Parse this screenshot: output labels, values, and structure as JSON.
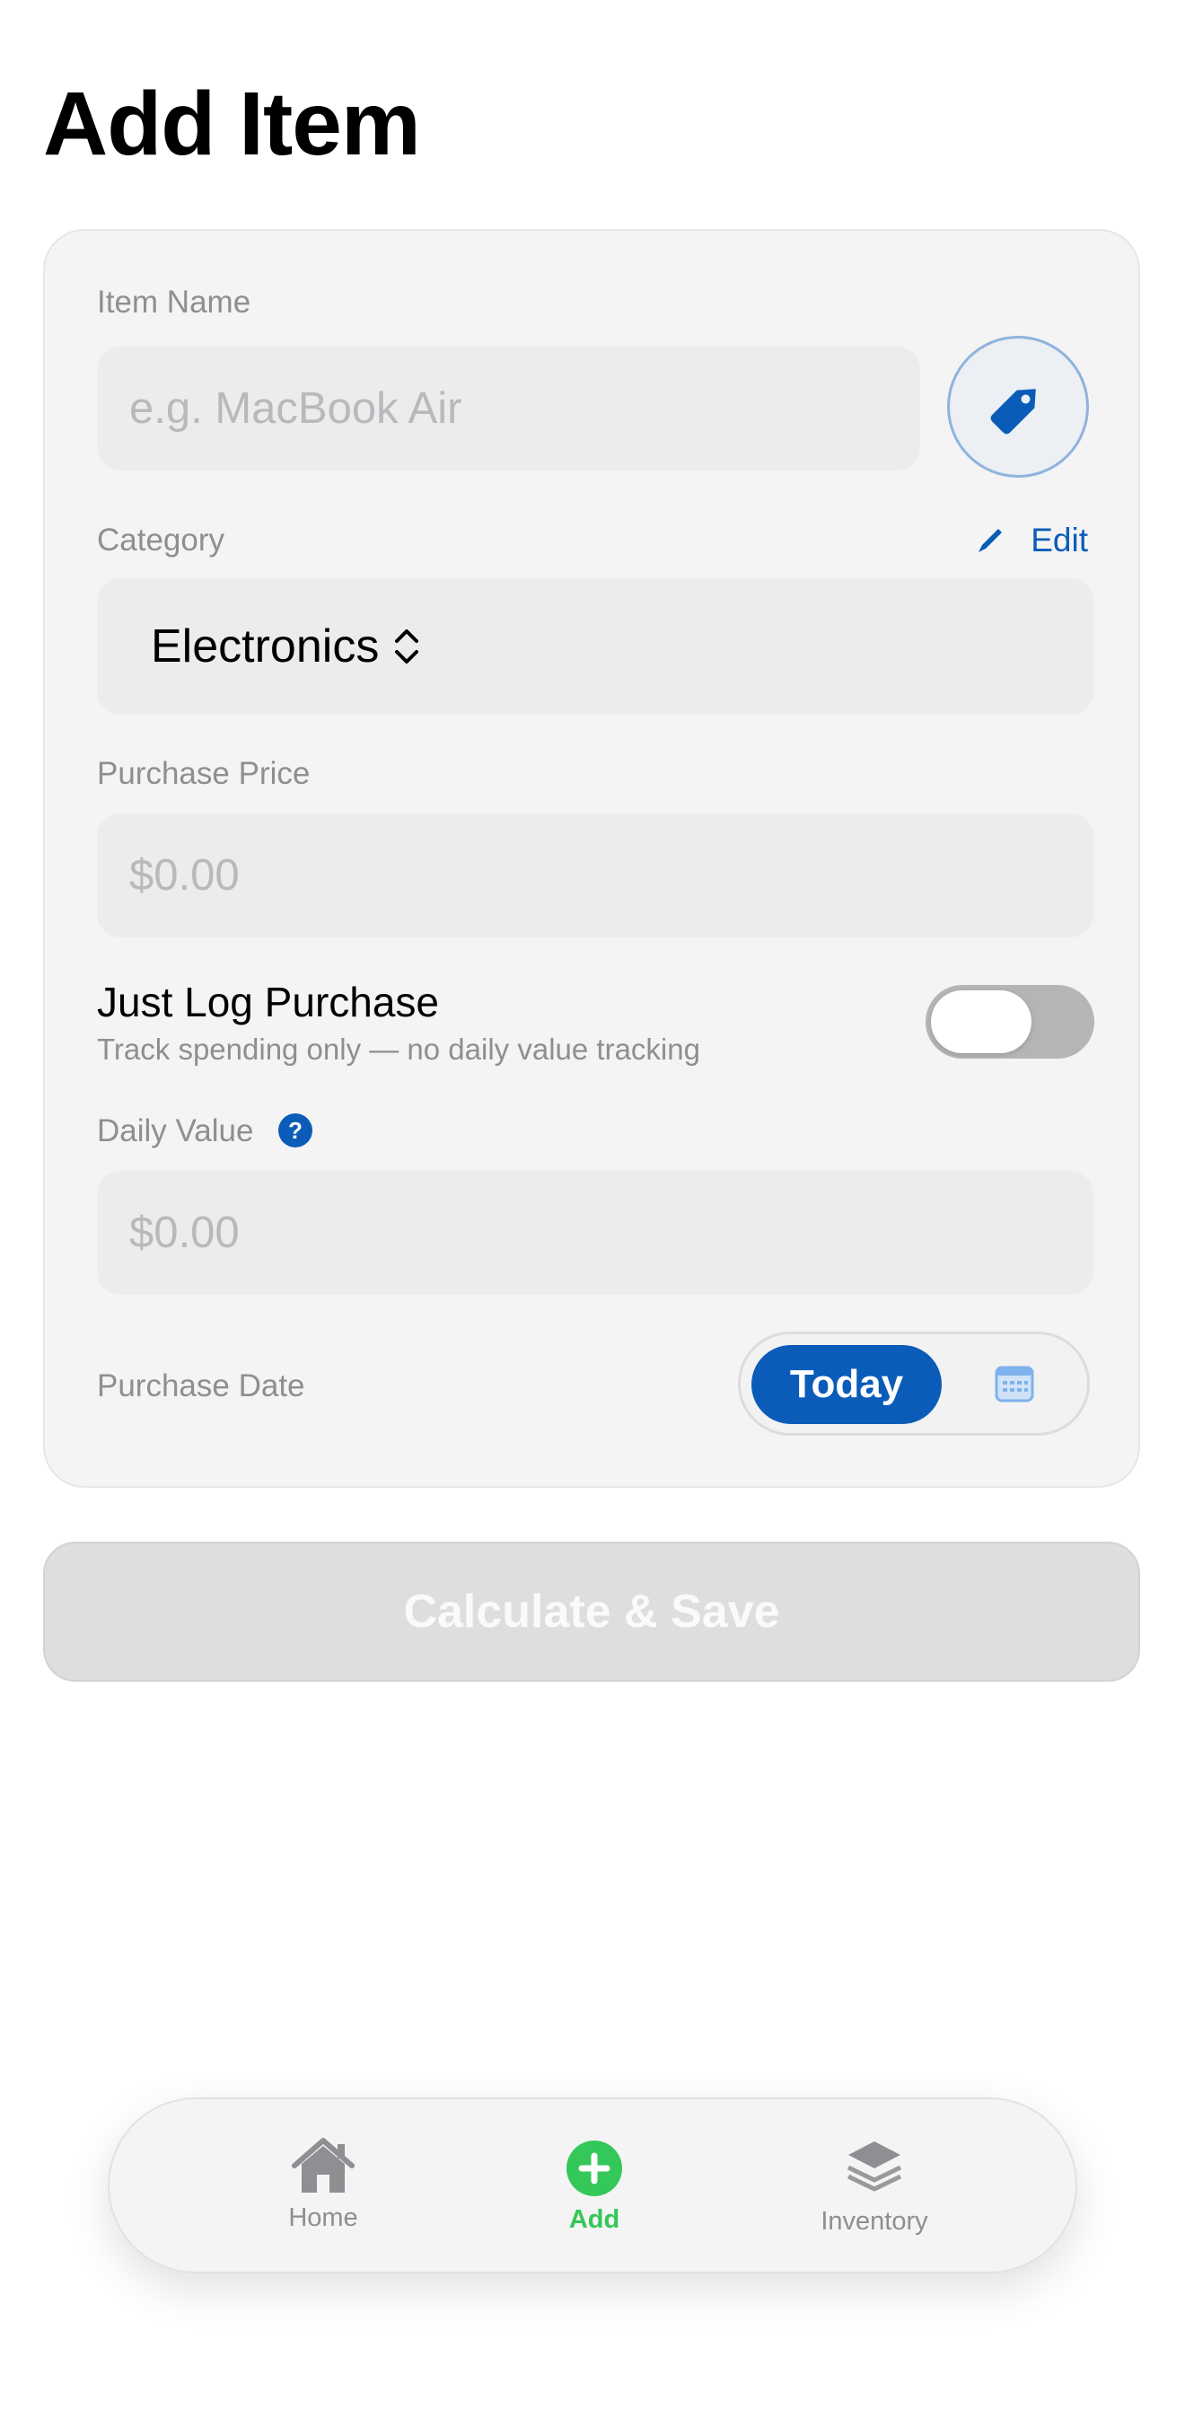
{
  "page": {
    "title": "Add Item"
  },
  "form": {
    "item_name": {
      "label": "Item Name",
      "placeholder": "e.g. MacBook Air"
    },
    "category": {
      "label": "Category",
      "edit_label": "Edit",
      "value": "Electronics"
    },
    "purchase_price": {
      "label": "Purchase Price",
      "placeholder": "$0.00"
    },
    "just_log": {
      "title": "Just Log Purchase",
      "subtitle": "Track spending only — no daily value tracking",
      "enabled": false
    },
    "daily_value": {
      "label": "Daily Value",
      "help_glyph": "?",
      "placeholder": "$0.00"
    },
    "purchase_date": {
      "label": "Purchase Date",
      "today_label": "Today"
    }
  },
  "actions": {
    "save_label": "Calculate & Save"
  },
  "tabbar": {
    "items": [
      {
        "label": "Home",
        "icon": "house-icon",
        "active": false
      },
      {
        "label": "Add",
        "icon": "plus-circle-icon",
        "active": true
      },
      {
        "label": "Inventory",
        "icon": "stack-icon",
        "active": false
      }
    ]
  },
  "colors": {
    "accent": "#0b5cb8",
    "active_tab": "#34c759",
    "muted": "#8e8e93"
  }
}
